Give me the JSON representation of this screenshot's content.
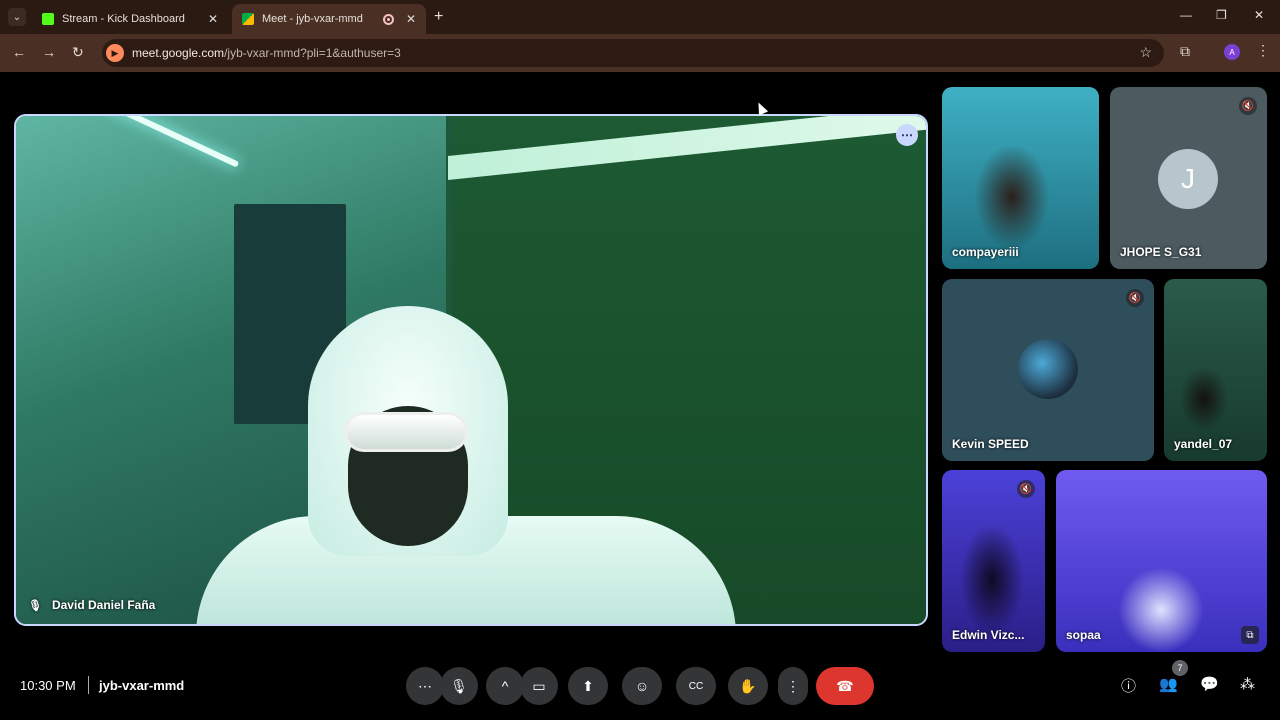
{
  "browser": {
    "tabs": [
      {
        "title": "Stream - Kick Dashboard",
        "favicon_color": "#53fc18",
        "active": false,
        "close": "✕"
      },
      {
        "title": "Meet - jyb-vxar-mmd",
        "favicon_color": "#00ac47",
        "active": true,
        "close": "✕"
      }
    ],
    "new_tab": "+",
    "window_controls": {
      "minimize": "—",
      "maximize": "❐",
      "close": "✕"
    },
    "nav": {
      "back": "←",
      "forward": "→",
      "reload": "↻"
    },
    "url_host": "meet.google.com",
    "url_rest": "/jyb-vxar-mmd?pli=1&authuser=3",
    "profile_initial": "A"
  },
  "meet": {
    "main_speaker": {
      "name": "David Daniel Faña"
    },
    "participants": [
      {
        "name": "compayeriii",
        "muted": false
      },
      {
        "name": "JHOPE S_G31",
        "initial": "J",
        "muted": true
      },
      {
        "name": "Kevin SPEED",
        "muted": true
      },
      {
        "name": "yandel_07",
        "muted": false
      },
      {
        "name": "Edwin Vizc...",
        "muted": true
      },
      {
        "name": "sopaa",
        "muted": false
      }
    ],
    "time": "10:30 PM",
    "meeting_code": "jyb-vxar-mmd",
    "participant_count": "7",
    "icons": {
      "more": "⋯",
      "mic": "🎙",
      "chevron": "^",
      "camera": "▭",
      "present": "⬆",
      "emoji": "☺",
      "captions": "CC",
      "raise_hand": "✋",
      "options": "⋮",
      "end_call": "☎",
      "info": "ⓘ",
      "people": "👥",
      "chat": "💬",
      "activities": "⁂"
    }
  }
}
